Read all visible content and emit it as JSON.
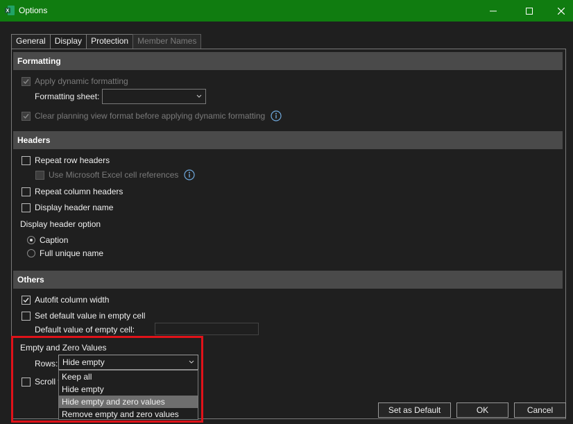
{
  "window": {
    "title": "Options"
  },
  "tabs": [
    {
      "label": "General"
    },
    {
      "label": "Display"
    },
    {
      "label": "Protection"
    },
    {
      "label": "Member Names"
    }
  ],
  "formatting": {
    "header": "Formatting",
    "apply_dynamic": "Apply dynamic formatting",
    "formatting_sheet_label": "Formatting sheet:",
    "formatting_sheet_value": "",
    "clear_planning": "Clear planning view format before applying dynamic formatting"
  },
  "headers": {
    "header": "Headers",
    "repeat_row": "Repeat row headers",
    "use_excel_refs": "Use Microsoft Excel cell references",
    "repeat_column": "Repeat column headers",
    "display_header_name": "Display header name",
    "display_header_option": "Display header option",
    "caption": "Caption",
    "full_unique_name": "Full unique name"
  },
  "others": {
    "header": "Others",
    "autofit": "Autofit column width",
    "set_default": "Set default value in empty cell",
    "default_value_label": "Default value of empty cell:",
    "default_value": "",
    "empty_zero_label": "Empty and Zero Values",
    "rows_label": "Rows:",
    "rows_value": "Hide empty",
    "scroll_label": "Scroll t",
    "dropdown_options": [
      "Keep all",
      "Hide empty",
      "Hide empty and zero values",
      "Remove empty and zero values"
    ]
  },
  "buttons": {
    "set_default": "Set as Default",
    "ok": "OK",
    "cancel": "Cancel"
  },
  "colors": {
    "titlebar": "#107c10",
    "highlight": "#e01219"
  }
}
